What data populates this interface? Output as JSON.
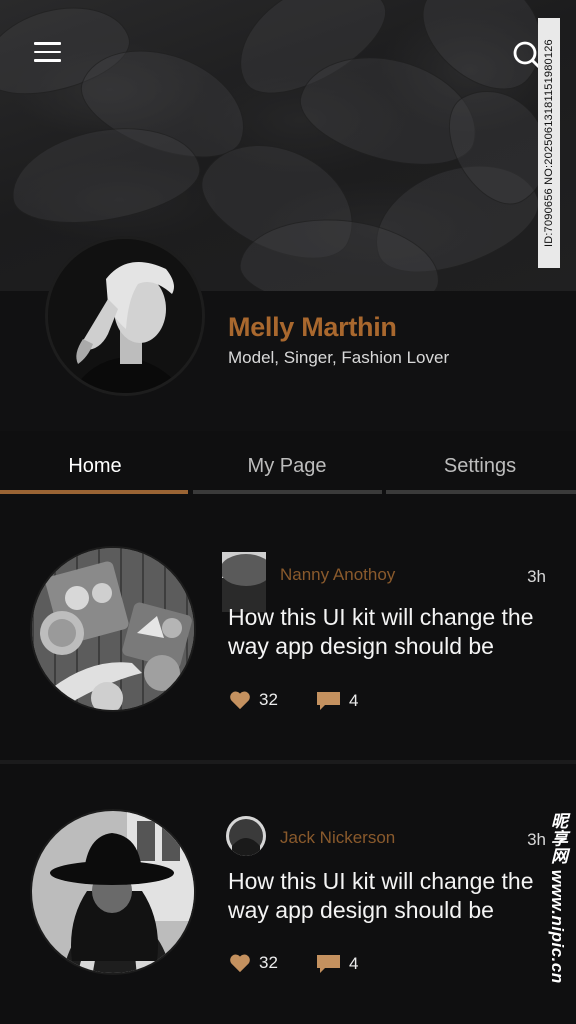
{
  "header": {
    "menu_icon": "hamburger-menu-icon",
    "search_icon": "search-icon",
    "watermark_id": "ID:7090656 NO:20250613181151980126"
  },
  "profile": {
    "name": "Melly Marthin",
    "bio": "Model, Singer, Fashion Lover"
  },
  "tabs": [
    {
      "label": "Home",
      "active": true
    },
    {
      "label": "My Page",
      "active": false
    },
    {
      "label": "Settings",
      "active": false
    }
  ],
  "colors": {
    "accent": "#a9682e",
    "background": "#0f0f10",
    "tab_active_line": "#9a6434",
    "tab_inactive_line": "#3a3a3a"
  },
  "posts": [
    {
      "author": "Nanny Anothoy",
      "time": "3h",
      "title": "How this UI kit will change the way app design should be",
      "likes": "32",
      "comments": "4"
    },
    {
      "author": "Jack Nickerson",
      "time": "3h",
      "title": "How this UI kit will change the way app design should be",
      "likes": "32",
      "comments": "4"
    }
  ],
  "site_watermark": "昵享网 www.nipic.cn"
}
